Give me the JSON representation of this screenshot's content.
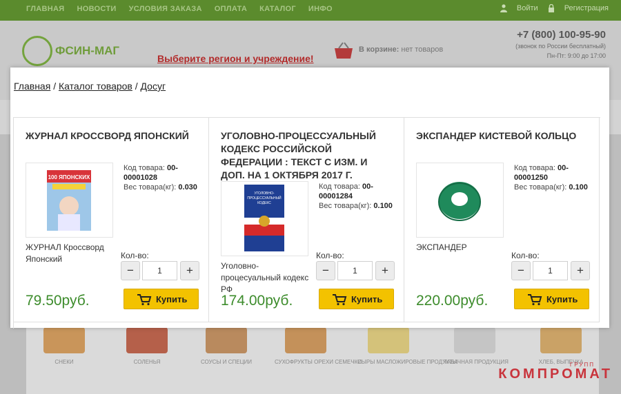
{
  "topnav": {
    "items": [
      "ГЛАВНАЯ",
      "НОВОСТИ",
      "УСЛОВИЯ ЗАКАЗА",
      "ОПЛАТА",
      "КАТАЛОГ",
      "ИНФО"
    ],
    "login": "Войти",
    "register": "Регистрация"
  },
  "header": {
    "logo_text": "ФСИН-МАГ",
    "promo": "Выберите регион и учреждение!",
    "cart_label": "В корзине:",
    "cart_status": "нет товаров",
    "phone": "+7 (800) 100-95-90",
    "phone_note": "(звонок по России бесплатный)",
    "hours": "Пн-Пт: 9:00 до 17:00"
  },
  "breadcrumb": {
    "home": "Главная",
    "catalog": "Каталог товаров",
    "current": "Досуг",
    "sep": "/"
  },
  "products": [
    {
      "title": "ЖУРНАЛ КРОССВОРД ЯПОНСКИЙ",
      "code_label": "Код товара:",
      "code": "00-00001028",
      "weight_label": "Вес товара(кг):",
      "weight": "0.030",
      "name": "ЖУРНАЛ Кроссворд Японский",
      "qty_label": "Кол-во:",
      "qty": "1",
      "price": "79.50руб.",
      "buy": "Купить",
      "thumb_text": "100 ЯПОНСКИХ СКАНВОРДОВ"
    },
    {
      "title": "УГОЛОВНО-ПРОЦЕССУАЛЬНЫЙ КОДЕКС РОССИЙСКОЙ ФЕДЕРАЦИИ : ТЕКСТ С ИЗМ. И ДОП. НА 1 ОКТЯБРЯ 2017 Г.",
      "code_label": "Код товара:",
      "code": "00-00001284",
      "weight_label": "Вес товара(кг):",
      "weight": "0.100",
      "name": "Уголовно-процесуальный кодекс РФ",
      "qty_label": "Кол-во:",
      "qty": "1",
      "price": "174.00руб.",
      "buy": "Купить",
      "thumb_text": "УГОЛОВНО-ПРОЦЕССУАЛЬНЫЙ КОДЕКС"
    },
    {
      "title": "ЭКСПАНДЕР КИСТЕВОЙ КОЛЬЦО",
      "code_label": "Код товара:",
      "code": "00-00001250",
      "weight_label": "Вес товара(кг):",
      "weight": "0.100",
      "name": "ЭКСПАНДЕР",
      "qty_label": "Кол-во:",
      "qty": "1",
      "price": "220.00руб.",
      "buy": "Купить"
    }
  ],
  "qty_controls": {
    "minus": "−",
    "plus": "+"
  },
  "categories": [
    "СНЕКИ",
    "СОЛЕНЬЯ",
    "СОУСЫ И СПЕЦИИ",
    "СУХОФРУКТЫ ОРЕХИ СЕМЕЧКИ",
    "СЫРЫ МАСЛОЖИРОВЫЕ ПРОДУКТЫ",
    "ТАБАЧНАЯ ПРОДУКЦИЯ",
    "ХЛЕБ, ВЫПЕЧКА"
  ],
  "watermark": {
    "small": "ГРУПП",
    "main": "КОМПРОМАТ"
  },
  "colors": {
    "nav_green": "#5b8b2d",
    "price_green": "#3d8c2c",
    "buy_yellow": "#f3c200",
    "watermark_red": "#c8343c"
  }
}
